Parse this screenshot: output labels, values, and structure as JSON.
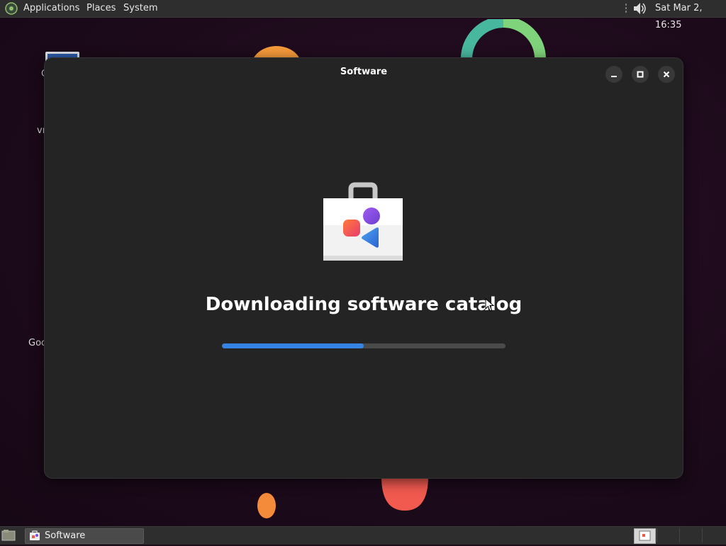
{
  "top_panel": {
    "menus": [
      "Applications",
      "Places",
      "System"
    ],
    "clock": "Sat Mar  2, 16:35"
  },
  "desktop": {
    "icon_labels": [
      "C",
      "vr",
      "Goo"
    ]
  },
  "window": {
    "title": "Software",
    "status": "Downloading software catalog",
    "progress_percent": 50,
    "colors": {
      "accent": "#3584e4",
      "background": "#242424"
    }
  },
  "taskbar": {
    "task_label": "Software"
  }
}
